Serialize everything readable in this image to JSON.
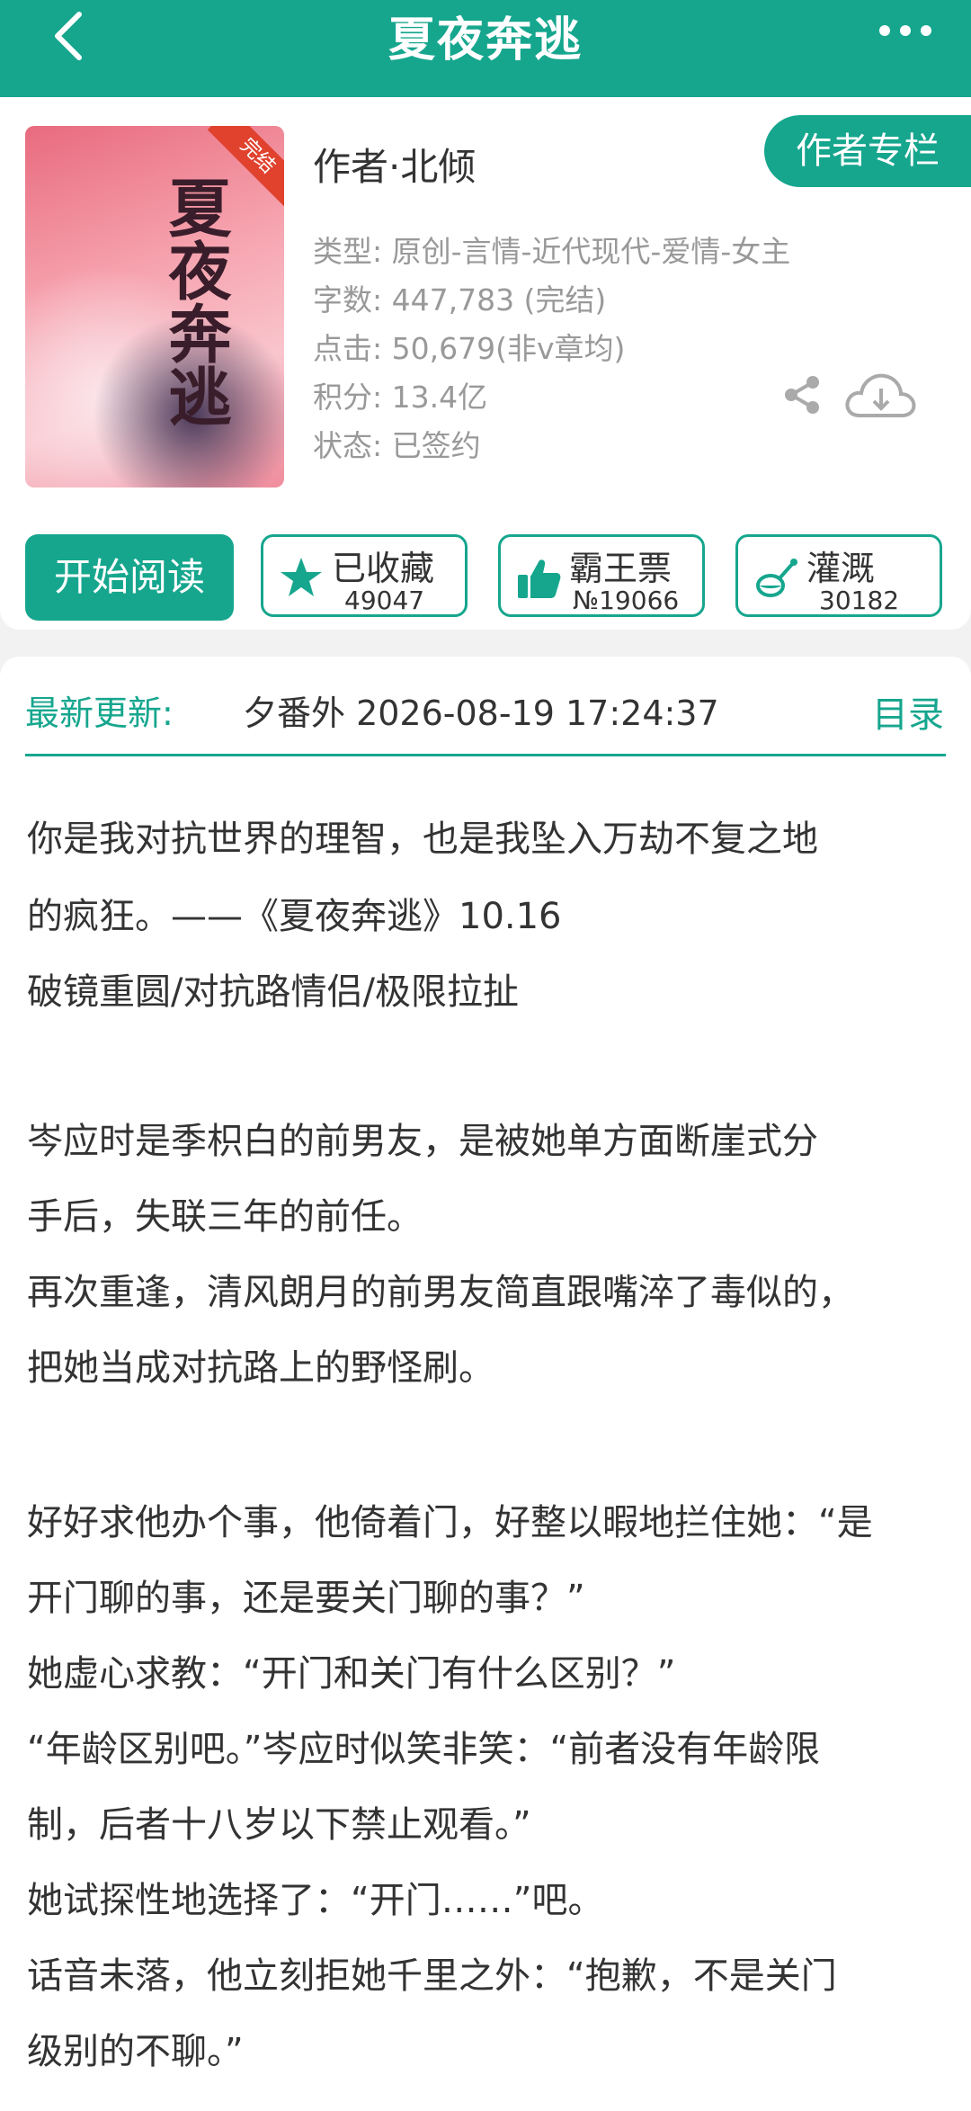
{
  "header": {
    "title": "夏夜奔逃",
    "back_icon": "chevron-left-icon",
    "more_icon": "more-dots-icon"
  },
  "book": {
    "cover_title": "夏夜奔逃",
    "cover_badge": "完结",
    "author": "作者·北倾",
    "author_column_label": "作者专栏",
    "type": "类型: 原创-言情-近代现代-爱情-女主",
    "word_count": "字数: 447,783 (完结)",
    "clicks": "点击: 50,679(非v章均)",
    "score": "积分: 13.4亿",
    "status": "状态: 已签约"
  },
  "actions": {
    "read_label": "开始阅读",
    "favorite": {
      "label": "已收藏",
      "count": "49047"
    },
    "ticket": {
      "label": "霸王票",
      "count": "№19066"
    },
    "water": {
      "label": "灌溉",
      "count": "30182"
    }
  },
  "update": {
    "label": "最新更新:",
    "text": "夕番外  2026-08-19 17:24:37",
    "catalog_label": "目录"
  },
  "synopsis": [
    "你是我对抗世界的理智，也是我坠入万劫不复之地",
    "的疯狂。——《夏夜奔逃》10.16",
    "破镜重圆/对抗路情侣/极限拉扯",
    "岑应时是季枳白的前男友，是被她单方面断崖式分",
    "手后，失联三年的前任。",
    "再次重逢，清风朗月的前男友简直跟嘴淬了毒似的，",
    "把她当成对抗路上的野怪刷。",
    "好好求他办个事，他倚着门，好整以暇地拦住她：“是",
    "开门聊的事，还是要关门聊的事？”",
    "她虚心求教：“开门和关门有什么区别？”",
    "“年龄区别吧。”岑应时似笑非笑：“前者没有年龄限",
    "制，后者十八岁以下禁止观看。”",
    "她试探性地选择了：“开门……”吧。",
    "话音未落，他立刻拒她千里之外：“抱歉，不是关门",
    "级别的不聊。”"
  ],
  "colors": {
    "accent": "#16a68e"
  }
}
